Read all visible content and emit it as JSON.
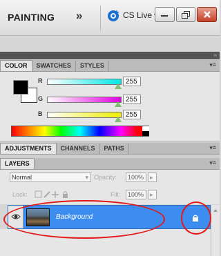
{
  "workspace": {
    "name": "PAINTING",
    "more_glyph": "»"
  },
  "cs_live": {
    "label": "CS Live",
    "caret": "▾",
    "icon": "cs-live-swirl-icon"
  },
  "window_controls": {
    "minimize": "minimize-icon",
    "restore": "restore-icon",
    "close": "close-icon"
  },
  "panel_strip": {
    "collapse_glyph": "››"
  },
  "color_panel": {
    "tabs": [
      {
        "label": "COLOR",
        "active": true
      },
      {
        "label": "SWATCHES",
        "active": false
      },
      {
        "label": "STYLES",
        "active": false
      }
    ],
    "sliders": [
      {
        "label": "R",
        "value": "255",
        "color": "#00e5e5"
      },
      {
        "label": "G",
        "value": "255",
        "color": "#e000e0"
      },
      {
        "label": "B",
        "value": "255",
        "color": "#eeee00"
      }
    ],
    "foreground_color": "#000000",
    "background_color": "#ffffff"
  },
  "adjustments_panel": {
    "tabs": [
      {
        "label": "ADJUSTMENTS",
        "active": true
      },
      {
        "label": "CHANNELS",
        "active": false
      },
      {
        "label": "PATHS",
        "active": false
      }
    ]
  },
  "layers_panel": {
    "tab": "LAYERS",
    "blend_mode": "Normal",
    "opacity_label": "Opacity:",
    "opacity_value": "100%",
    "lock_label": "Lock:",
    "fill_label": "Fill:",
    "fill_value": "100%",
    "layers": [
      {
        "name": "Background",
        "visible": true,
        "locked": true,
        "selected": true
      }
    ]
  },
  "annotations": {
    "color": "#e21919"
  }
}
